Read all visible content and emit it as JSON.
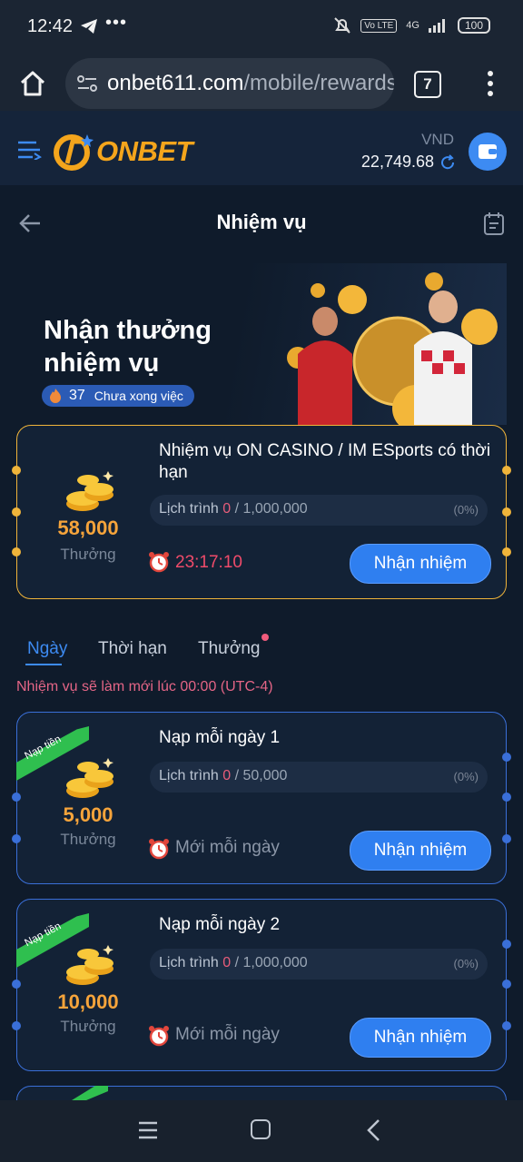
{
  "status_bar": {
    "time": "12:42",
    "dots": "•••",
    "volte": "Vo LTE",
    "network": "4G",
    "battery": "100"
  },
  "browser": {
    "url_domain": "onbet611.com",
    "url_path": "/mobile/rewards",
    "tab_count": "7"
  },
  "app_header": {
    "logo_text": "ONBET",
    "currency": "VND",
    "balance": "22,749.68"
  },
  "page": {
    "title": "Nhiệm vụ"
  },
  "banner": {
    "title": "Nhận thưởng nhiệm vụ",
    "count": "37",
    "status_label": "Chưa xong việc"
  },
  "featured_task": {
    "title": "Nhiệm vụ ON CASINO / IM ESports có thời hạn",
    "reward": "58,000",
    "reward_label": "Thưởng",
    "progress_label": "Lịch trình",
    "progress_current": "0",
    "progress_target": " / 1,000,000",
    "progress_percent": "(0%)",
    "timer": "23:17:10",
    "button": "Nhận nhiệm"
  },
  "tabs": [
    {
      "label": "Ngày"
    },
    {
      "label": "Thời hạn"
    },
    {
      "label": "Thưởng"
    }
  ],
  "refresh_note": "Nhiệm vụ sẽ làm mới lúc 00:00 (UTC-4)",
  "daily_tasks": [
    {
      "ribbon": "Nạp tiền",
      "title": "Nạp mỗi ngày 1",
      "reward": "5,000",
      "reward_label": "Thưởng",
      "progress_label": "Lịch trình",
      "progress_current": "0",
      "progress_target": " / 50,000",
      "progress_percent": "(0%)",
      "schedule": "Mới mỗi ngày",
      "button": "Nhận nhiệm"
    },
    {
      "ribbon": "Nạp tiền",
      "title": "Nạp mỗi ngày 2",
      "reward": "10,000",
      "reward_label": "Thưởng",
      "progress_label": "Lịch trình",
      "progress_current": "0",
      "progress_target": " / 1,000,000",
      "progress_percent": "(0%)",
      "schedule": "Mới mỗi ngày",
      "button": "Nhận nhiệm"
    }
  ],
  "colors": {
    "accent": "#3d8bf2",
    "gold": "#f0b43a",
    "reward": "#f6a43b",
    "timer": "#ef4b6a",
    "ribbon": "#2fbf4f"
  },
  "icons": [
    "telegram-icon",
    "home-icon",
    "tune-icon",
    "more-vert-icon",
    "menu-icon",
    "refresh-icon",
    "wallet-icon",
    "back-arrow-icon",
    "calendar-icon",
    "fire-icon",
    "coins-icon",
    "alarm-clock-icon",
    "nav-recents-icon",
    "nav-home-icon",
    "nav-back-icon"
  ]
}
